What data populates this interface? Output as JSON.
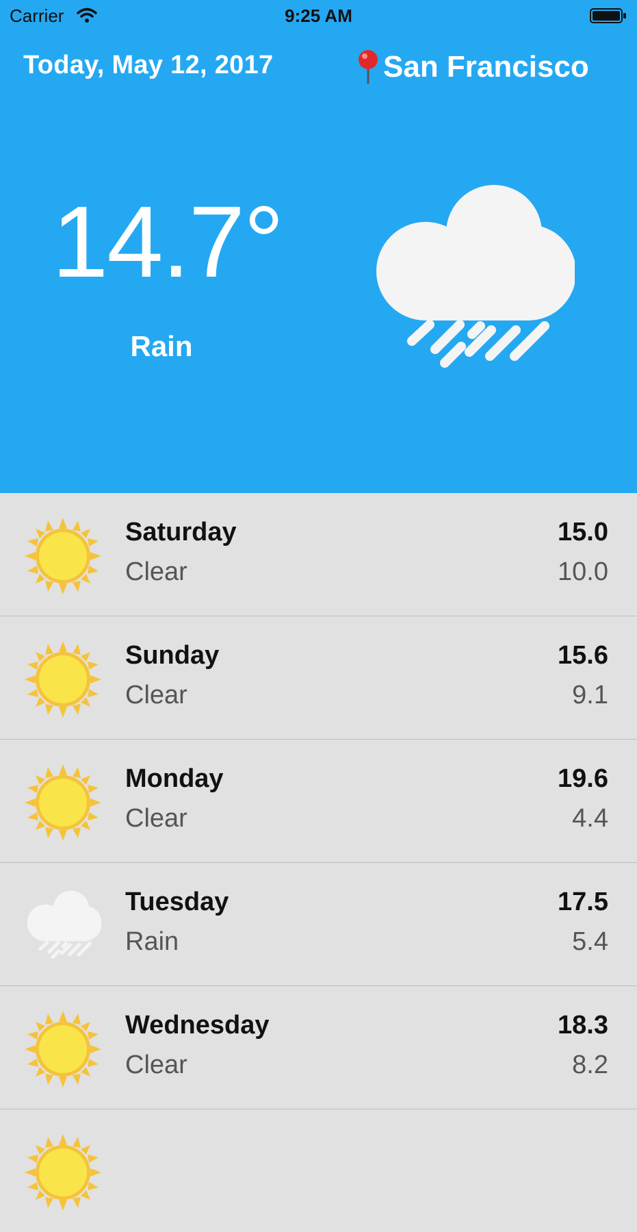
{
  "status_bar": {
    "carrier": "Carrier",
    "time": "9:25 AM"
  },
  "header": {
    "date": "Today, May 12, 2017",
    "city": "San Francisco",
    "pin_icon": "map-pin-icon"
  },
  "current": {
    "temperature": "14.7°",
    "condition": "Rain",
    "icon": "rain-cloud-icon"
  },
  "forecast": [
    {
      "day": "Saturday",
      "condition": "Clear",
      "high": "15.0",
      "low": "10.0",
      "icon": "sun-icon"
    },
    {
      "day": "Sunday",
      "condition": "Clear",
      "high": "15.6",
      "low": "9.1",
      "icon": "sun-icon"
    },
    {
      "day": "Monday",
      "condition": "Clear",
      "high": "19.6",
      "low": "4.4",
      "icon": "sun-icon"
    },
    {
      "day": "Tuesday",
      "condition": "Rain",
      "high": "17.5",
      "low": "5.4",
      "icon": "rain-cloud-icon"
    },
    {
      "day": "Wednesday",
      "condition": "Clear",
      "high": "18.3",
      "low": "8.2",
      "icon": "sun-icon"
    }
  ],
  "colors": {
    "hero_background": "#25a8f2",
    "list_background": "#e1e1e1",
    "sun": "#f9e54a",
    "sun_rays": "#f5c33b"
  }
}
